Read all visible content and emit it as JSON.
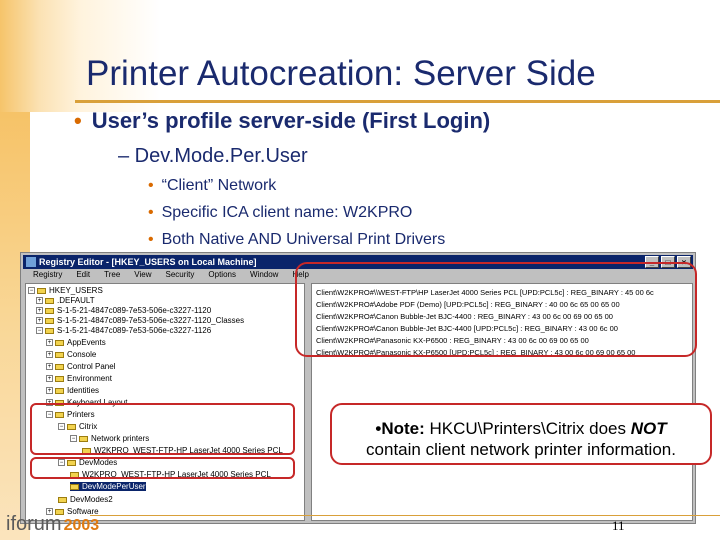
{
  "slide": {
    "title": "Printer Autocreation: Server Side",
    "bullet1": "User’s profile server-side (First Login)",
    "bullet2": "– Dev.Mode.Per.User",
    "sub_bullets": [
      "“Client” Network",
      "Specific ICA client name: W2KPRO",
      "Both Native AND Universal Print Drivers"
    ],
    "bullet_glyph": "•",
    "page_number": "11",
    "logo_text": "iforum",
    "logo_year": "2003"
  },
  "regedit": {
    "title": "Registry Editor - [HKEY_USERS on Local Machine]",
    "window_buttons": [
      "_",
      "□",
      "×"
    ],
    "menu": [
      "Registry",
      "Edit",
      "Tree",
      "View",
      "Security",
      "Options",
      "Window",
      "Help"
    ],
    "tree": [
      "HKEY_USERS",
      ".DEFAULT",
      "S-1-5-21-4847c089-7e53-506e-c3227-1120",
      "S-1-5-21-4847c089-7e53-506e-c3227-1120_Classes",
      "S-1-5-21-4847c089-7e53-506e-c3227-1126",
      "AppEvents",
      "Console",
      "Control Panel",
      "Environment",
      "Identities",
      "Keyboard Layout",
      "Printers",
      "Citrix",
      "Network printers",
      "W2KPRO_WEST-FTP-HP LaserJet 4000 Series PCL",
      "DevModes",
      "W2KPRO_WEST-FTP-HP LaserJet 4000 Series PCL",
      "DevModePerUser",
      "DevModes2",
      "Software"
    ],
    "values": [
      "Client\\W2KPRO#\\\\WEST-FTP\\HP LaserJet 4000 Series PCL [UPD:PCL5c] : REG_BINARY : 45 00 6c",
      "Client\\W2KPRO#\\Adobe PDF (Demo) [UPD:PCL5c] : REG_BINARY : 40 00 6c 65 00 65 00",
      "Client\\W2KPRO#\\Canon Bubble-Jet BJC-4400 : REG_BINARY : 43 00 6c 00 69 00 65 00",
      "Client\\W2KPRO#\\Canon Bubble-Jet BJC-4400 [UPD:PCL5c] : REG_BINARY : 43 00 6c 00",
      "Client\\W2KPRO#\\Panasonic KX-P6500 : REG_BINARY : 43 00 6c 00 69 00 65 00",
      "Client\\W2KPRO#\\Panasonic KX-P6500 [UPD:PCL5c] : REG_BINARY : 43 00 6c 00 69 00 65 00"
    ]
  },
  "note": {
    "label": "•Note:",
    "text1": " HKCU\\Printers\\Citrix does ",
    "emph": "NOT",
    "text2": "contain client network printer information."
  }
}
